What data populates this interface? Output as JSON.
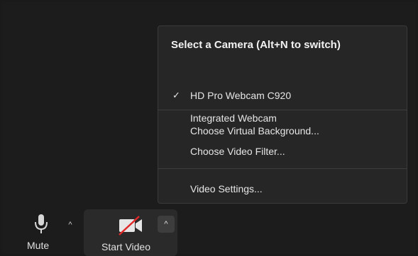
{
  "camera_menu": {
    "title": "Select a Camera (Alt+N to switch)",
    "cameras": [
      {
        "label": "HD Pro Webcam C920",
        "selected": true
      },
      {
        "label": "Integrated Webcam",
        "selected": false
      }
    ],
    "check_glyph": "✓",
    "options": [
      {
        "label": "Choose Virtual Background..."
      },
      {
        "label": "Choose Video Filter..."
      }
    ],
    "settings_label": "Video Settings..."
  },
  "toolbar": {
    "mute_label": "Mute",
    "start_video_label": "Start Video",
    "caret_glyph": "^",
    "mute_icon": "microphone-icon",
    "video_icon": "camera-off-icon"
  },
  "colors": {
    "background": "#1c1c1c",
    "menu_background": "#262626",
    "video_off_slash": "#e02828"
  }
}
